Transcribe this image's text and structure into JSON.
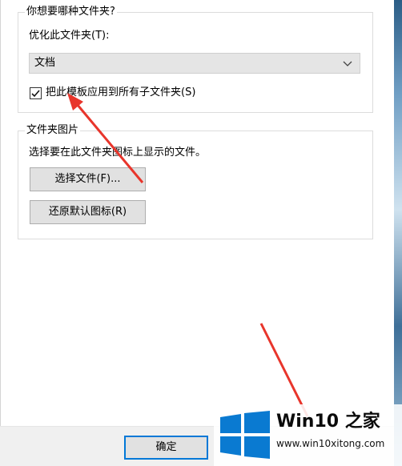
{
  "customize_group": {
    "title": "你想要哪种文件夹?",
    "optimize_label": "优化此文件夹(T):",
    "optimize_selected": "文档",
    "apply_subfolders_label": "把此模板应用到所有子文件夹(S)",
    "apply_subfolders_checked": true
  },
  "picture_group": {
    "title": "文件夹图片",
    "description": "选择要在此文件夹图标上显示的文件。",
    "choose_file_label": "选择文件(F)...",
    "restore_default_label": "还原默认图标(R)"
  },
  "footer": {
    "ok_label": "确定"
  },
  "watermark": {
    "title_prefix": "Win10",
    "title_suffix": " 之家",
    "url": "www.win10xitong.com",
    "logo": "windows-logo"
  },
  "colors": {
    "arrow": "#e8352b",
    "logo_blue": "#0a7ad1",
    "ok_border": "#0078d7"
  }
}
